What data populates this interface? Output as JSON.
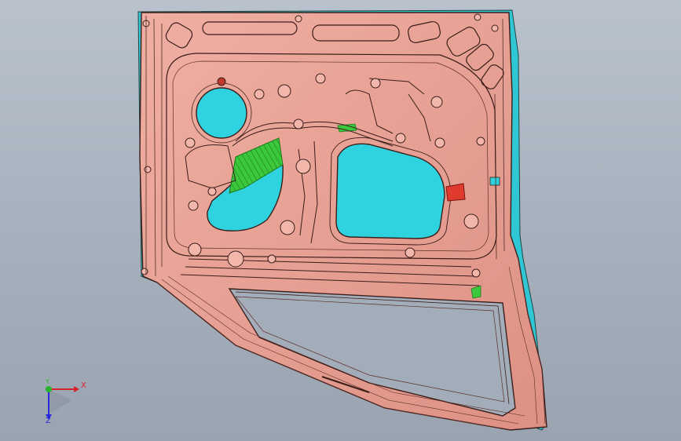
{
  "viewport": {
    "background_top": "#b9c2cc",
    "background_bottom": "#9aa4b1"
  },
  "model": {
    "part": "door-inner-panel",
    "body_color": "#e9a195",
    "edge_color": "#3a1e1a",
    "opening_color": "#2fd3e0",
    "highlight_green": "#3cc83c",
    "highlight_red": "#e03a2e"
  },
  "triad": {
    "x_label": "X",
    "y_label": "Y",
    "z_label": "Z",
    "x_color": "#d8202a",
    "y_color": "#2bb32b",
    "z_color": "#2a2ad8"
  }
}
